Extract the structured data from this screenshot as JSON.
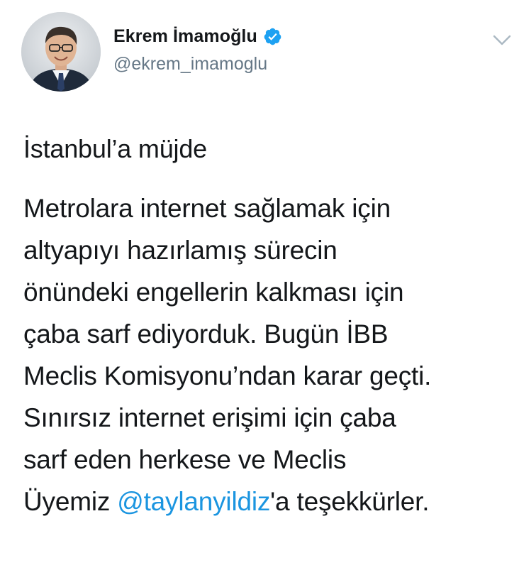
{
  "author": {
    "display_name": "Ekrem İmamoğlu",
    "handle": "@ekrem_imamoglu",
    "verified": true,
    "avatar_icon": "profile-photo"
  },
  "header": {
    "menu_icon": "chevron-down-icon"
  },
  "tweet": {
    "headline": "İstanbul’a müjde",
    "body_lines": [
      "Metrolara internet sağlamak için",
      "altyapıyı hazırlamış sürecin",
      "önündeki engellerin kalkması için",
      "çaba sarf ediyorduk. Bugün İBB",
      "Meclis Komisyonu’ndan karar geçti.",
      "Sınırsız internet erişimi için çaba",
      "sarf eden herkese ve Meclis"
    ],
    "last_line": {
      "prefix": "Üyemiz ",
      "mention": "@taylanyildiz",
      "suffix": "'a teşekkürler."
    }
  },
  "colors": {
    "text": "#14171a",
    "secondary": "#657786",
    "link": "#1b95e0",
    "verified": "#1da1f2"
  }
}
